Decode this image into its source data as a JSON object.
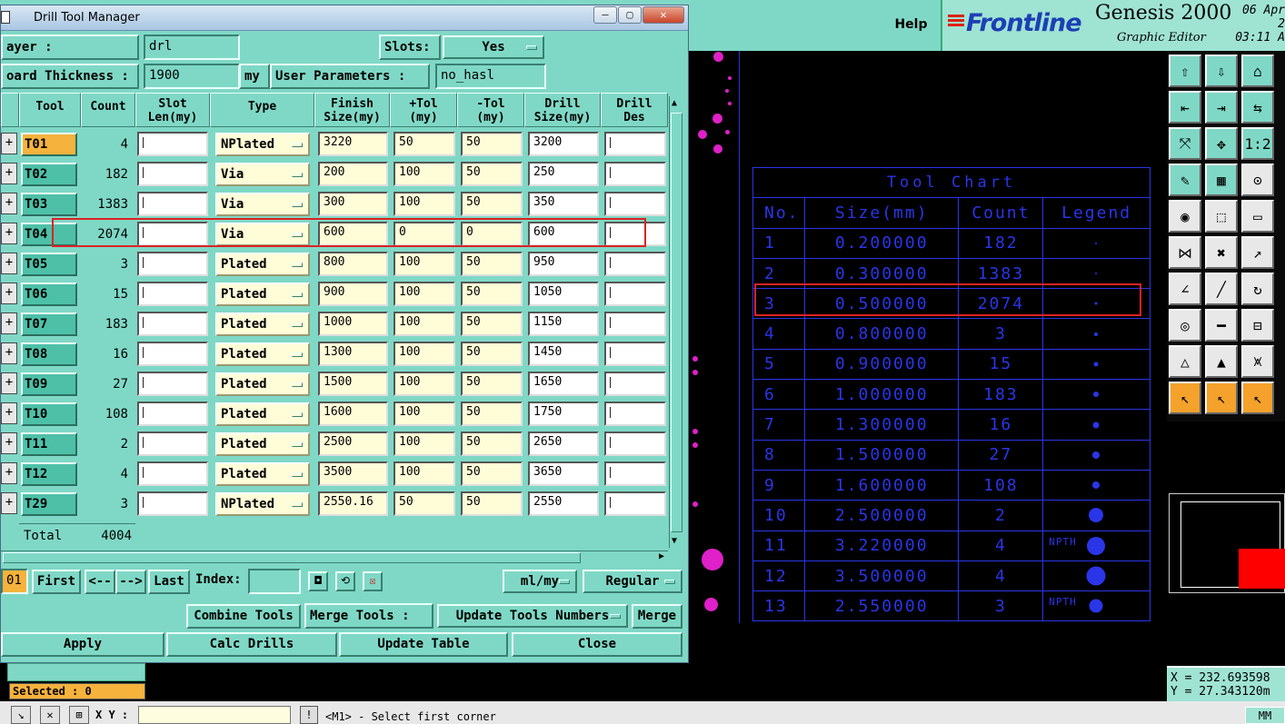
{
  "app": {
    "help_label": "Help",
    "brand_logo": "Frontline",
    "brand_name": "Genesis 2000",
    "brand_sub": "Graphic Editor",
    "date_line1": "06 Apr 2",
    "date_line2": "03:11 A"
  },
  "dialog": {
    "title": "Drill Tool Manager",
    "layer_label": "ayer :",
    "layer_value": "drl",
    "slots_label": "Slots:",
    "slots_value": "Yes",
    "board_thickness_label": "oard Thickness :",
    "board_thickness_value": "1900",
    "board_thickness_unit": "my",
    "user_params_label": "User Parameters :",
    "user_params_value": "no_hasl"
  },
  "table": {
    "headers": {
      "tool": "Tool",
      "count": "Count",
      "slot_len_1": "Slot",
      "slot_len_2": "Len(my)",
      "type": "Type",
      "finish_1": "Finish",
      "finish_2": "Size(my)",
      "ptol_1": "+Tol",
      "ptol_2": "(my)",
      "ntol_1": "-Tol",
      "ntol_2": "(my)",
      "drill_1": "Drill",
      "drill_2": "Size(my)",
      "des_1": "Drill",
      "des_2": "Des"
    },
    "rows": [
      {
        "tool": "T01",
        "count": "4",
        "type": "NPlated",
        "finish": "3220",
        "ptol": "50",
        "ntol": "50",
        "drill": "3200"
      },
      {
        "tool": "T02",
        "count": "182",
        "type": "Via",
        "finish": "200",
        "ptol": "100",
        "ntol": "50",
        "drill": "250"
      },
      {
        "tool": "T03",
        "count": "1383",
        "type": "Via",
        "finish": "300",
        "ptol": "100",
        "ntol": "50",
        "drill": "350"
      },
      {
        "tool": "T04",
        "count": "2074",
        "type": "Via",
        "finish": "600",
        "ptol": "0",
        "ntol": "0",
        "drill": "600"
      },
      {
        "tool": "T05",
        "count": "3",
        "type": "Plated",
        "finish": "800",
        "ptol": "100",
        "ntol": "50",
        "drill": "950"
      },
      {
        "tool": "T06",
        "count": "15",
        "type": "Plated",
        "finish": "900",
        "ptol": "100",
        "ntol": "50",
        "drill": "1050"
      },
      {
        "tool": "T07",
        "count": "183",
        "type": "Plated",
        "finish": "1000",
        "ptol": "100",
        "ntol": "50",
        "drill": "1150"
      },
      {
        "tool": "T08",
        "count": "16",
        "type": "Plated",
        "finish": "1300",
        "ptol": "100",
        "ntol": "50",
        "drill": "1450"
      },
      {
        "tool": "T09",
        "count": "27",
        "type": "Plated",
        "finish": "1500",
        "ptol": "100",
        "ntol": "50",
        "drill": "1650"
      },
      {
        "tool": "T10",
        "count": "108",
        "type": "Plated",
        "finish": "1600",
        "ptol": "100",
        "ntol": "50",
        "drill": "1750"
      },
      {
        "tool": "T11",
        "count": "2",
        "type": "Plated",
        "finish": "2500",
        "ptol": "100",
        "ntol": "50",
        "drill": "2650"
      },
      {
        "tool": "T12",
        "count": "4",
        "type": "Plated",
        "finish": "3500",
        "ptol": "100",
        "ntol": "50",
        "drill": "3650"
      },
      {
        "tool": "T29",
        "count": "3",
        "type": "NPlated",
        "finish": "2550.16",
        "ptol": "50",
        "ntol": "50",
        "drill": "2550"
      }
    ],
    "row_button": "+",
    "total_label": "Total",
    "total_value": "4004"
  },
  "nav": {
    "current": "01",
    "first": "First",
    "prev": "<--",
    "next": "-->",
    "last": "Last",
    "index_label": "Index:",
    "index_value": "",
    "units": "ml/my",
    "mode": "Regular"
  },
  "actions": {
    "combine": "Combine Tools",
    "merge_label": "Merge Tools :",
    "merge_mode": "Update Tools Numbers",
    "merge": "Merge",
    "apply": "Apply",
    "calc": "Calc Drills",
    "update": "Update Table",
    "close": "Close"
  },
  "tool_chart": {
    "title": "Tool Chart",
    "headers": {
      "no": "No.",
      "size": "Size(mm)",
      "count": "Count",
      "legend": "Legend"
    },
    "npth_label": "NPTH",
    "rows": [
      {
        "no": "1",
        "size": "0.200000",
        "count": "182",
        "npth": false
      },
      {
        "no": "2",
        "size": "0.300000",
        "count": "1383",
        "npth": false
      },
      {
        "no": "3",
        "size": "0.500000",
        "count": "2074",
        "npth": false
      },
      {
        "no": "4",
        "size": "0.800000",
        "count": "3",
        "npth": false
      },
      {
        "no": "5",
        "size": "0.900000",
        "count": "15",
        "npth": false
      },
      {
        "no": "6",
        "size": "1.000000",
        "count": "183",
        "npth": false
      },
      {
        "no": "7",
        "size": "1.300000",
        "count": "16",
        "npth": false
      },
      {
        "no": "8",
        "size": "1.500000",
        "count": "27",
        "npth": false
      },
      {
        "no": "9",
        "size": "1.600000",
        "count": "108",
        "npth": false
      },
      {
        "no": "10",
        "size": "2.500000",
        "count": "2",
        "npth": false
      },
      {
        "no": "11",
        "size": "3.220000",
        "count": "4",
        "npth": true
      },
      {
        "no": "12",
        "size": "3.500000",
        "count": "4",
        "npth": false
      },
      {
        "no": "13",
        "size": "2.550000",
        "count": "3",
        "npth": true
      }
    ]
  },
  "status": {
    "selected": "Selected : 0",
    "xy_label": "X Y :",
    "message": "<M1> - Select first corner",
    "units": "MM",
    "x_readout": "X = 232.693598",
    "y_readout": "Y = 27.343120m"
  },
  "colors": {
    "accent": "#7fd8c6",
    "chart_blue": "#2a35e8",
    "highlight_red": "#dd2222",
    "selected_orange": "#f5b23c",
    "pad_magenta": "#e020c8"
  }
}
